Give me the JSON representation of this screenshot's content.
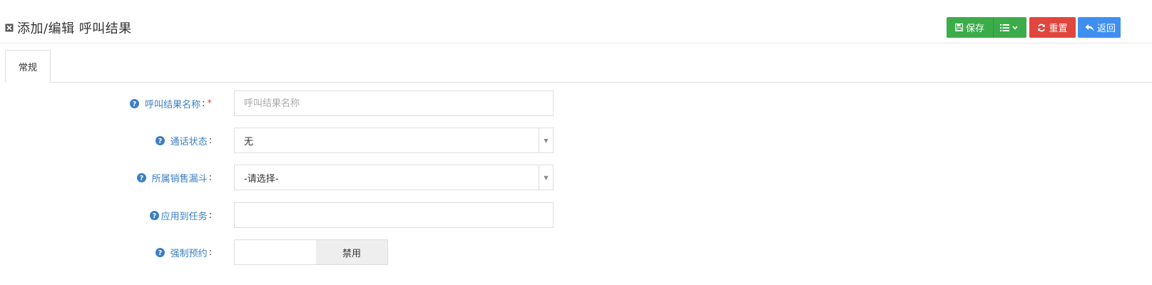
{
  "header": {
    "title": "添加/编辑 呼叫结果",
    "title_icon": "close-square-icon"
  },
  "toolbar": {
    "save_label": "保存",
    "reset_label": "重置",
    "back_label": "返回",
    "colors": {
      "save": "#3cac4a",
      "reset": "#e0463e",
      "back": "#3f8ff0"
    }
  },
  "tabs": [
    {
      "label": "常规",
      "active": true
    }
  ],
  "form": {
    "name": {
      "label": "呼叫结果名称",
      "colon": ":",
      "required_mark": "*",
      "placeholder": "呼叫结果名称",
      "value": ""
    },
    "call_status": {
      "label": "通话状态",
      "colon": ":",
      "value": "无"
    },
    "funnel": {
      "label": "所属销售漏斗",
      "colon": ":",
      "value": "-请选择-"
    },
    "apply_task": {
      "label": "应用到任务",
      "colon": ":",
      "value": ""
    },
    "force_appointment": {
      "label": "强制预约",
      "colon": ":",
      "switch_label": "禁用",
      "state": "off"
    }
  },
  "colors": {
    "label": "#3a7fc4",
    "border": "#dddddd"
  }
}
